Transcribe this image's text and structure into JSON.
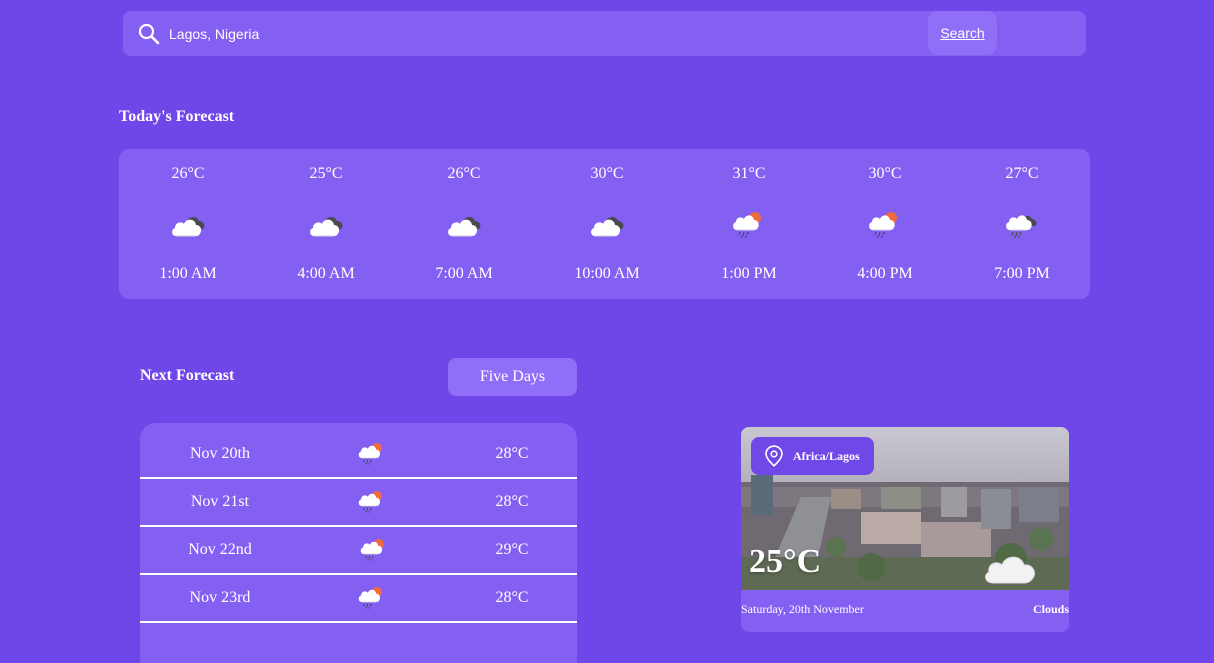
{
  "search": {
    "value": "Lagos, Nigeria",
    "button_label": "Search"
  },
  "today": {
    "title": "Today's Forecast",
    "hours": [
      {
        "temp": "26°C",
        "time": "1:00 AM",
        "icon": "cloudy-icon"
      },
      {
        "temp": "25°C",
        "time": "4:00 AM",
        "icon": "cloudy-icon"
      },
      {
        "temp": "26°C",
        "time": "7:00 AM",
        "icon": "cloudy-icon"
      },
      {
        "temp": "30°C",
        "time": "10:00 AM",
        "icon": "cloudy-icon"
      },
      {
        "temp": "31°C",
        "time": "1:00 PM",
        "icon": "sun-rain-icon"
      },
      {
        "temp": "30°C",
        "time": "4:00 PM",
        "icon": "sun-rain-icon"
      },
      {
        "temp": "27°C",
        "time": "7:00 PM",
        "icon": "cloud-rain-icon"
      }
    ]
  },
  "next": {
    "title": "Next Forecast",
    "range_button": "Five Days",
    "days": [
      {
        "date": "Nov 20th",
        "temp": "28°C",
        "icon": "sun-rain-icon"
      },
      {
        "date": "Nov 21st",
        "temp": "28°C",
        "icon": "sun-rain-icon"
      },
      {
        "date": "Nov 22nd",
        "temp": "29°C",
        "icon": "sun-rain-icon"
      },
      {
        "date": "Nov 23rd",
        "temp": "28°C",
        "icon": "sun-rain-icon"
      }
    ]
  },
  "city": {
    "location": "Africa/Lagos",
    "temp": "25°C",
    "date": "Saturday, 20th November",
    "condition": "Clouds",
    "icon": "cloud-icon"
  },
  "colors": {
    "background": "#6f47e9",
    "panel": "#8360f2",
    "button": "#8f6ef8",
    "sun": "#ef6a3d"
  }
}
